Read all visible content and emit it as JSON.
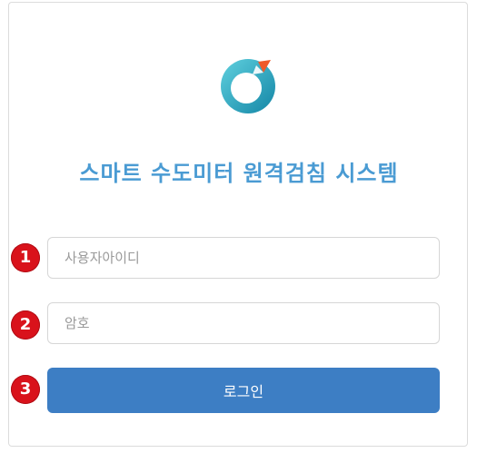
{
  "title": "스마트 수도미터 원격검침 시스템",
  "login_form": {
    "username_placeholder": "사용자아이디",
    "password_placeholder": "암호",
    "login_label": "로그인"
  },
  "markers": [
    "1",
    "2",
    "3"
  ],
  "colors": {
    "title": "#4a9bd3",
    "button": "#3d7ec4",
    "marker": "#d9121b",
    "logo_teal": "#1a9fb8",
    "logo_arrow": "#ef5a2a"
  },
  "icons": {
    "logo": "compass-logo-icon"
  }
}
